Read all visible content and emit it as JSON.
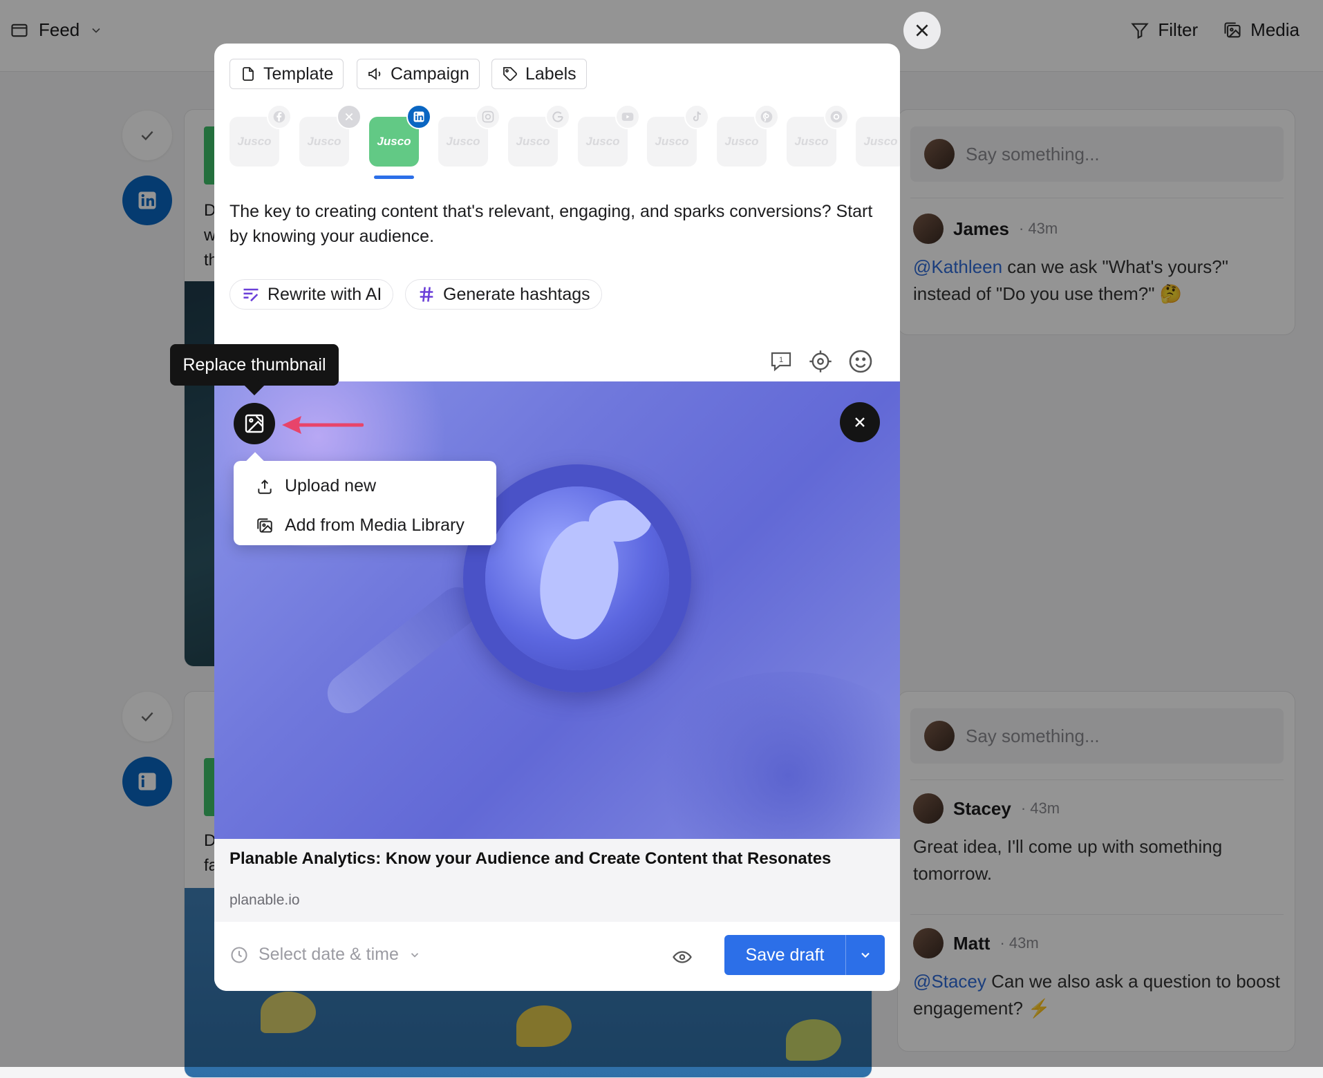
{
  "topbar": {
    "view_label": "Feed",
    "filter_label": "Filter",
    "media_label": "Media"
  },
  "feed": {
    "post1_text_lines": [
      "D",
      "w",
      "th"
    ],
    "post2_text_lines": [
      "D",
      "fa"
    ]
  },
  "comments_panel_1": {
    "placeholder": "Say something...",
    "comments": [
      {
        "author": "James",
        "time": "· 43m",
        "mention": "@Kathleen",
        "text": " can we ask \"What's yours?\" instead of \"Do you use them?\" 🤔"
      }
    ]
  },
  "comments_panel_2": {
    "placeholder": "Say something...",
    "comments": [
      {
        "author": "Stacey",
        "time": "· 43m",
        "mention": "",
        "text": "Great idea, I'll come up with something tomorrow."
      },
      {
        "author": "Matt",
        "time": "· 43m",
        "mention": "@Stacey",
        "text": " Can we also ask a question to boost engagement? ⚡"
      }
    ]
  },
  "modal": {
    "toolbar": {
      "template_label": "Template",
      "campaign_label": "Campaign",
      "labels_label": "Labels"
    },
    "accounts": [
      {
        "name": "Jusco",
        "network": "facebook-icon",
        "active": false
      },
      {
        "name": "Jusco",
        "network": "x-icon",
        "active": false
      },
      {
        "name": "Jusco",
        "network": "linkedin-icon",
        "active": true
      },
      {
        "name": "Jusco",
        "network": "instagram-icon",
        "active": false
      },
      {
        "name": "Jusco",
        "network": "google-icon",
        "active": false
      },
      {
        "name": "Jusco",
        "network": "youtube-icon",
        "active": false
      },
      {
        "name": "Jusco",
        "network": "tiktok-icon",
        "active": false
      },
      {
        "name": "Jusco",
        "network": "pinterest-icon",
        "active": false
      },
      {
        "name": "Jusco",
        "network": "threads-icon",
        "active": false
      },
      {
        "name": "Jusco",
        "network": "",
        "active": false
      }
    ],
    "caption": "The key to creating content that's relevant, engaging, and sparks conversions? Start by knowing your audience.",
    "ai_actions": {
      "rewrite_label": "Rewrite with AI",
      "hashtags_label": "Generate hashtags"
    },
    "comment_count": "1",
    "tooltip": "Replace thumbnail",
    "thumbnail_menu": {
      "upload_label": "Upload new",
      "library_label": "Add from Media Library"
    },
    "link_preview": {
      "title": "Planable Analytics: Know your Audience and Create Content that Resonates",
      "domain": "planable.io"
    },
    "footer": {
      "date_placeholder": "Select date & time",
      "save_label": "Save draft"
    }
  },
  "colors": {
    "primary": "#2c6fe8",
    "linkedin": "#0a66c2",
    "account_active": "#62c985",
    "arrow": "#e8446a"
  }
}
